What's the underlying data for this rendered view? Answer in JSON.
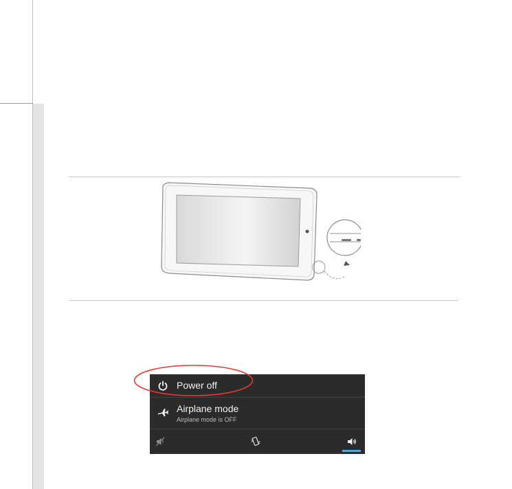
{
  "power_menu": {
    "power_off_label": "Power off",
    "airplane_title": "Airplane mode",
    "airplane_status": "Airplane mode is OFF",
    "icons": {
      "power": "power-icon",
      "airplane": "airplane-icon",
      "silent": "silent-mode-icon",
      "vibrate": "vibrate-mode-icon",
      "sound": "sound-on-icon"
    },
    "selected_sound_mode": "sound",
    "accent_color": "#33b5e5",
    "highlight_color": "#e53935"
  }
}
